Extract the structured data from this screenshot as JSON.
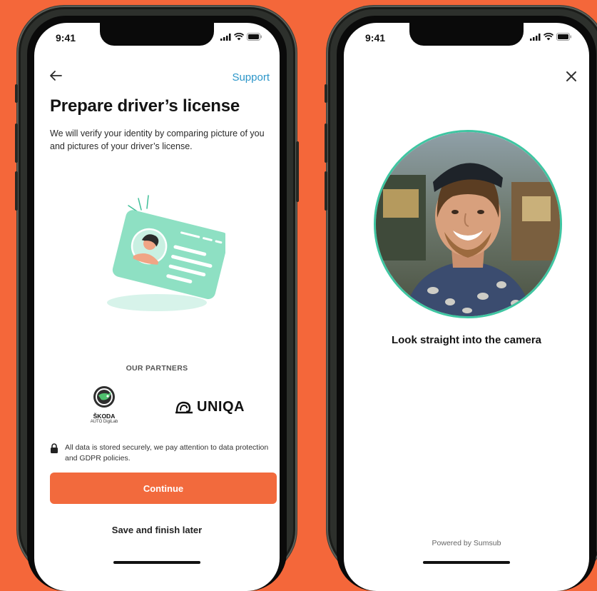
{
  "colors": {
    "background": "#f4673a",
    "accent": "#f26a3d",
    "link": "#2c96c9",
    "ring": "#3fc6a2"
  },
  "left_screen": {
    "status": {
      "time": "9:41"
    },
    "nav": {
      "back_icon": "arrow-left-icon",
      "support_label": "Support"
    },
    "title": "Prepare driver’s license",
    "description": "We will verify your identity by comparing picture of you and pictures of your driver’s license.",
    "partners": {
      "label": "OUR PARTNERS",
      "items": [
        {
          "name": "ŠKODA",
          "subtitle": "AUTO DigiLab"
        },
        {
          "name": "UNIQA"
        }
      ]
    },
    "security_note": "All data is stored securely, we pay attention to data protection and GDPR policies.",
    "continue_label": "Continue",
    "save_later_label": "Save and finish later"
  },
  "right_screen": {
    "status": {
      "time": "9:41"
    },
    "close_icon": "close-icon",
    "instruction": "Look straight into the camera",
    "powered_by": "Powered by Sumsub"
  }
}
